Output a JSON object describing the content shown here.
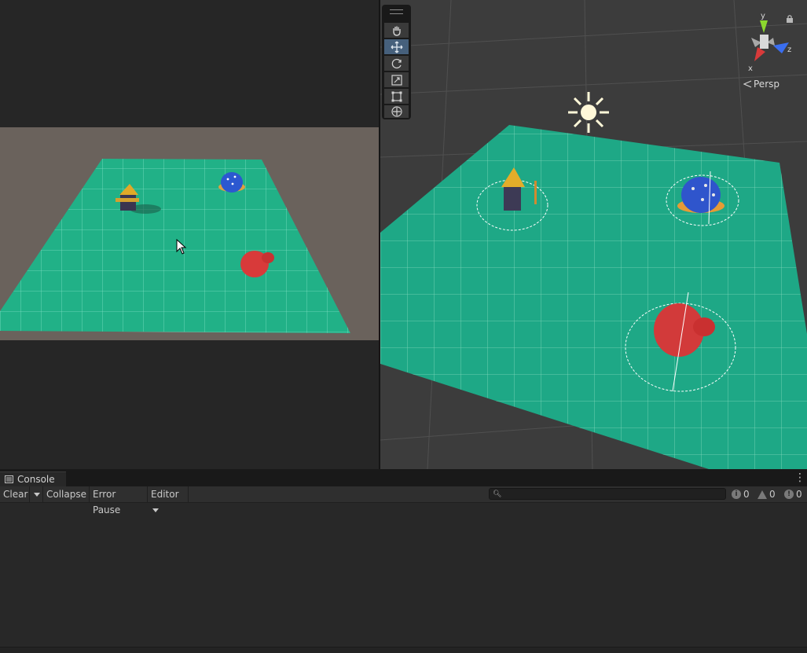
{
  "console": {
    "tab_label": "Console",
    "clear_label": "Clear",
    "collapse_label": "Collapse",
    "error_pause_label": "Error Pause",
    "editor_label": "Editor",
    "search_placeholder": "",
    "log_count": "0",
    "warning_count": "0",
    "error_count": "0",
    "menu_icon": "kebab-icon"
  },
  "scene": {
    "projection_label": "Persp",
    "axes": {
      "y": "y",
      "x": "x",
      "z": "z"
    },
    "tools": [
      "hand-tool",
      "move-tool",
      "rotate-tool",
      "scale-tool",
      "rect-tool",
      "transform-tool"
    ],
    "active_tool": "move-tool"
  },
  "colors": {
    "ground": "#1fb48a",
    "game_background": "#6a625c",
    "panel": "#282828",
    "active_tool": "#46607c"
  }
}
